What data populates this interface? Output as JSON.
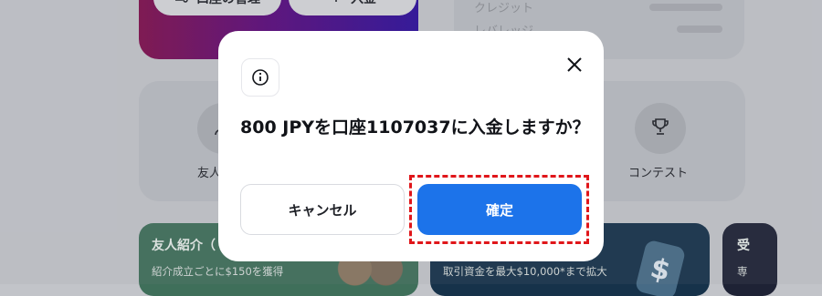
{
  "background": {
    "account_card": {
      "manage_label": "口座の管理",
      "deposit_label": "入金"
    },
    "info_card": {
      "credit_label": "クレジット",
      "leverage_label": "レバレッジ"
    },
    "quick_actions": {
      "friend_label": "友人",
      "contest_label": "コンテスト"
    },
    "promos": {
      "friend_title": "友人紹介（",
      "friend_sub": "紹介成立ごとに$150を獲得",
      "funds_sub": "取引資金を最大$10,000*まで拡大",
      "third_title": "受",
      "third_sub": "専"
    }
  },
  "modal": {
    "message": "800 JPYを口座1107037に入金しますか？",
    "cancel_label": "キャンセル",
    "confirm_label": "確定"
  },
  "colors": {
    "confirm": "#1c73ea",
    "highlight": "#e0161a"
  }
}
